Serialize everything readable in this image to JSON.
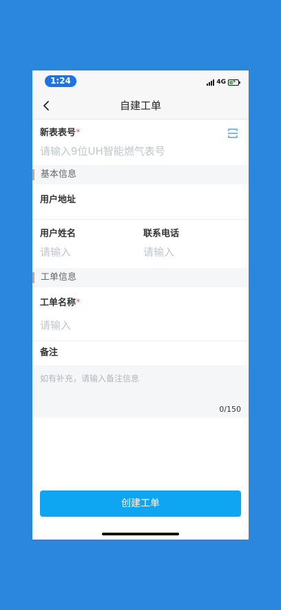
{
  "status_bar": {
    "time": "1:24",
    "network": "4G"
  },
  "nav": {
    "title": "自建工单"
  },
  "meter": {
    "label": "新表表号",
    "required_mark": "*",
    "placeholder": "请输入9位UH智能燃气表号",
    "scan_icon": "scan-icon"
  },
  "sections": {
    "basic": "基本信息",
    "order": "工单信息"
  },
  "basic": {
    "address_label": "用户地址",
    "name_label": "用户姓名",
    "name_placeholder": "请输入",
    "phone_label": "联系电话",
    "phone_placeholder": "请输入"
  },
  "order": {
    "name_label": "工单名称",
    "required_mark": "*",
    "name_placeholder": "请输入",
    "remark_label": "备注",
    "remark_placeholder": "如有补充，请输入备注信息",
    "remark_counter": "0/150"
  },
  "submit_label": "创建工单",
  "colors": {
    "page_background": "#2b86dd",
    "primary_button": "#0ea5f2",
    "required": "#f0643c",
    "section_accent": "#f0a050"
  }
}
